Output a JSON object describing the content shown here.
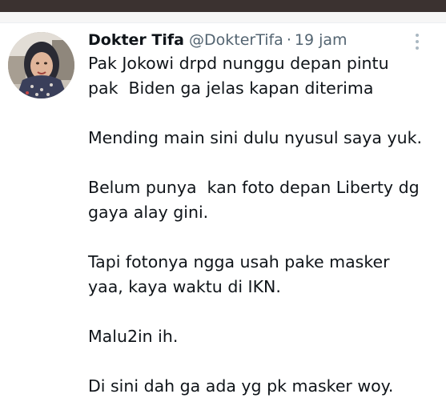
{
  "tweet": {
    "author_name": "Dokter Tifa",
    "handle": "@DokterTifa",
    "separator": "·",
    "time": "19 jam",
    "paragraphs": [
      "Pak Jokowi drpd nunggu depan pintu\npak  Biden ga jelas kapan diterima",
      "Mending main sini dulu nyusul saya yuk.",
      "Belum punya  kan foto depan Liberty dg\ngaya alay gini.",
      "Tapi fotonya ngga usah pake masker\nyaa, kaya waktu di IKN.",
      "Malu2in ih.",
      "Di sini dah ga ada yg pk masker woy."
    ]
  },
  "icons": {
    "more": "more-options-icon",
    "avatar": "avatar"
  }
}
